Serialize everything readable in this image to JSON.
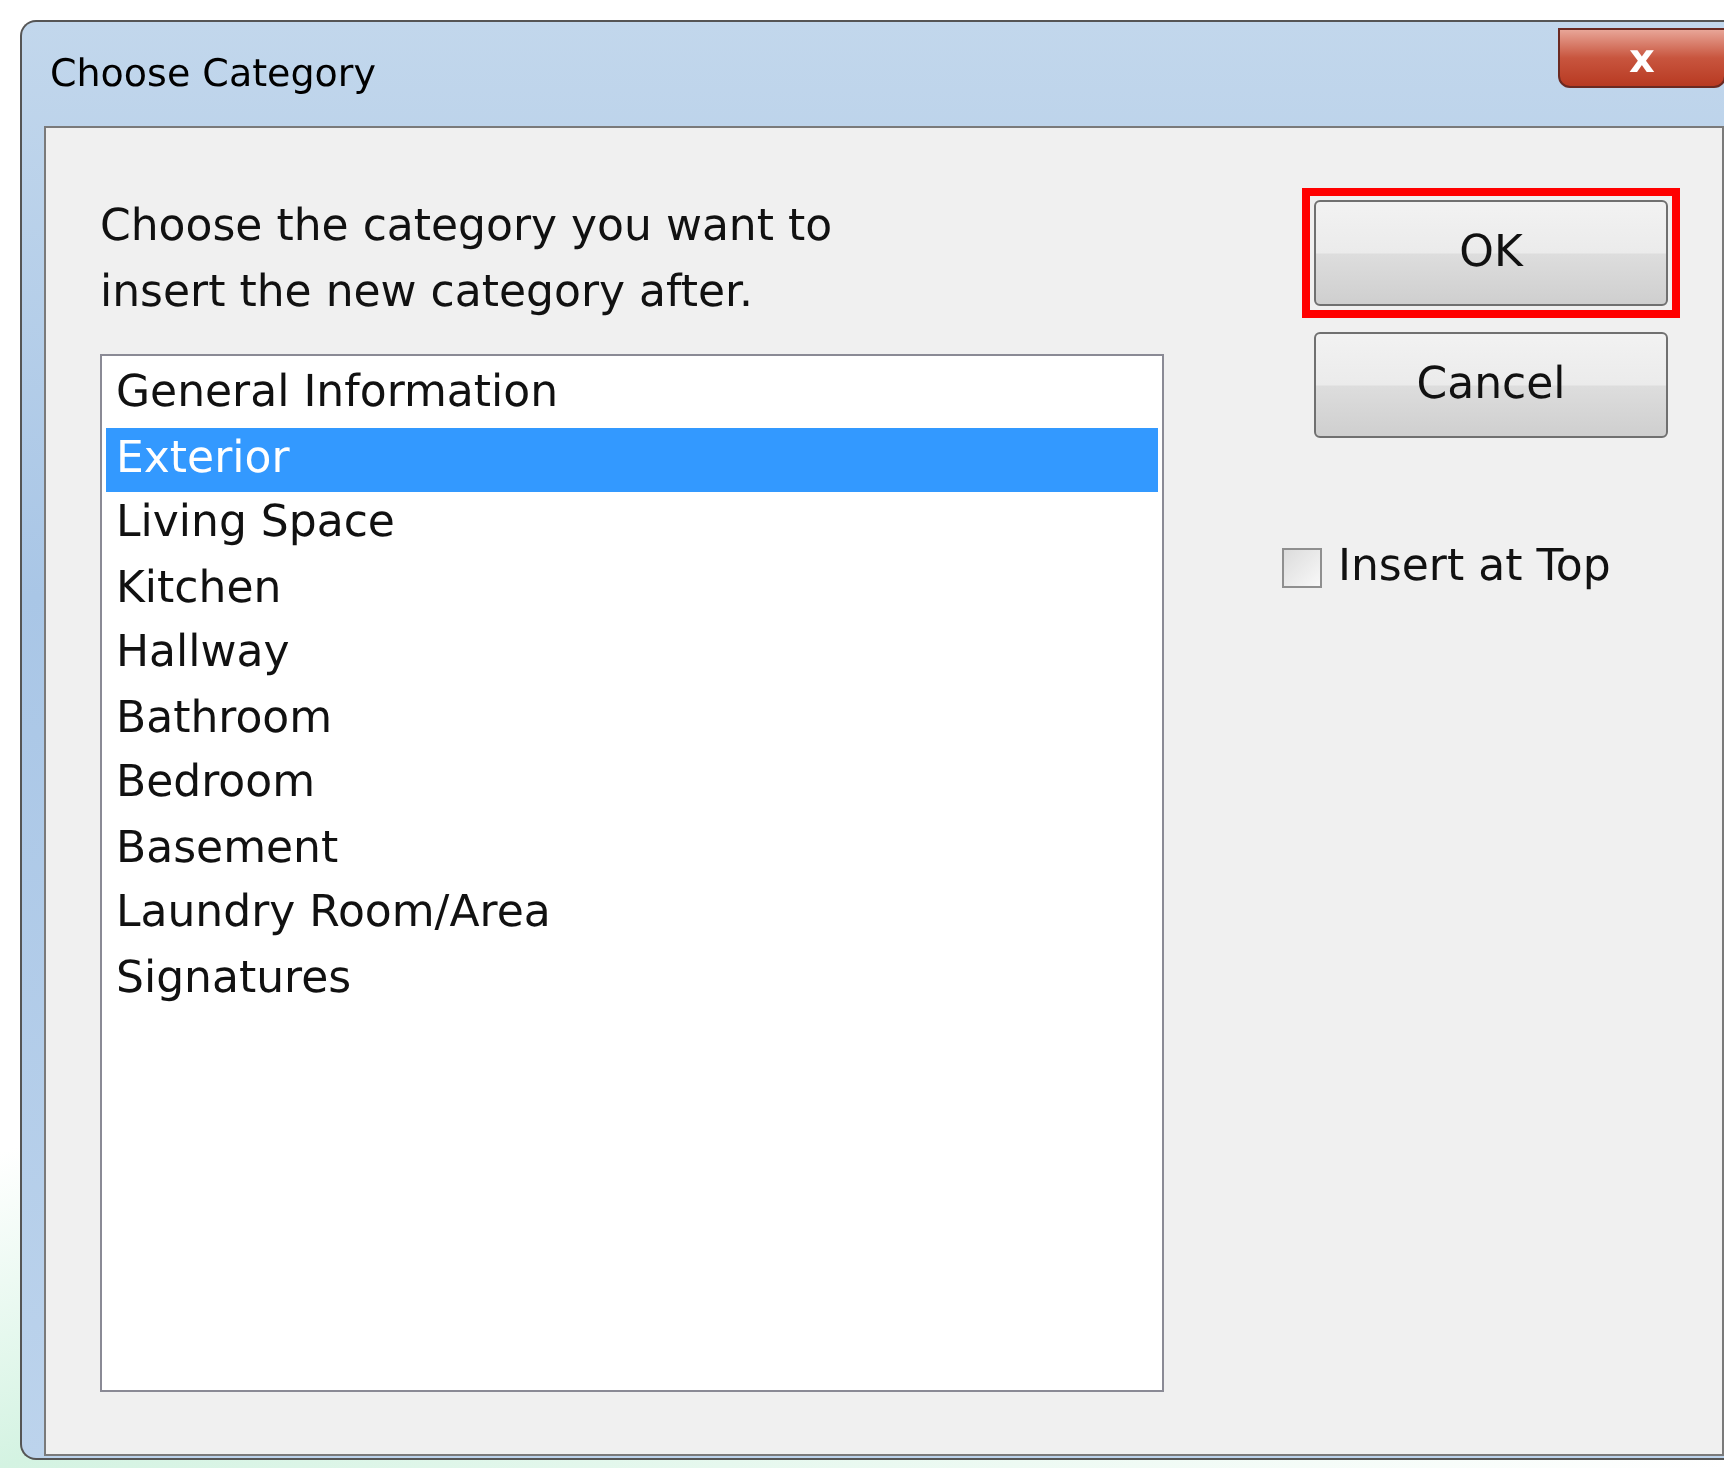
{
  "window": {
    "title": "Choose Category",
    "close_symbol": "x"
  },
  "prompt": "Choose the category you want to insert the new category after.",
  "categories": [
    {
      "label": "General Information",
      "selected": false
    },
    {
      "label": "Exterior",
      "selected": true
    },
    {
      "label": "Living Space",
      "selected": false
    },
    {
      "label": "Kitchen",
      "selected": false
    },
    {
      "label": "Hallway",
      "selected": false
    },
    {
      "label": "Bathroom",
      "selected": false
    },
    {
      "label": "Bedroom",
      "selected": false
    },
    {
      "label": "Basement",
      "selected": false
    },
    {
      "label": "Laundry Room/Area",
      "selected": false
    },
    {
      "label": "Signatures",
      "selected": false
    }
  ],
  "buttons": [
    {
      "label": "OK",
      "highlighted": true
    },
    {
      "label": "Cancel",
      "highlighted": false
    }
  ],
  "insert_at_top": {
    "label": "Insert at Top",
    "checked": false
  }
}
